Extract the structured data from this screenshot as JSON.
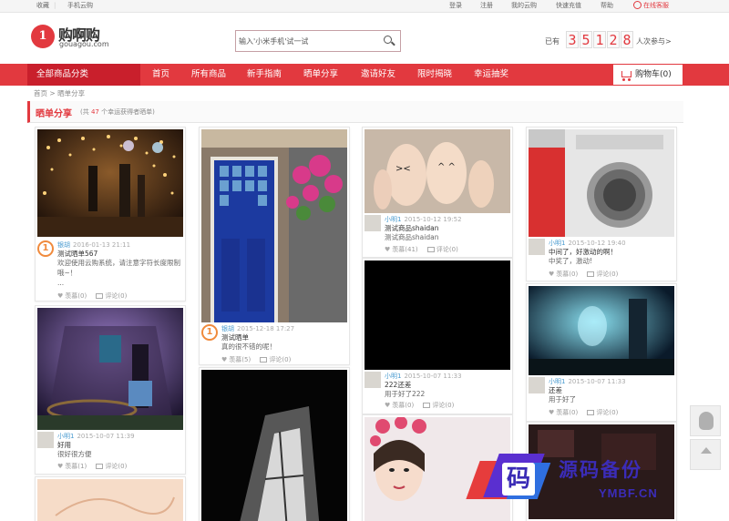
{
  "topbar": {
    "favorite": "收藏",
    "mobile": "手机云购",
    "login": "登录",
    "register": "注册",
    "my_yungou": "我的云购",
    "recharge": "快速充值",
    "help": "帮助",
    "service": "在线客服"
  },
  "header": {
    "logo_mark": "1",
    "logo_cn": "购啊购",
    "logo_en": "gouagou.com",
    "search_placeholder": "输入'小米手机'试一试",
    "counter_prefix": "已有",
    "counter_digits": [
      "3",
      "5",
      "1",
      "2",
      "8"
    ],
    "counter_suffix": "人次参与>"
  },
  "nav": {
    "all_categories": "全部商品分类",
    "items": [
      "首页",
      "所有商品",
      "新手指南",
      "晒单分享",
      "邀请好友",
      "限时揭晓",
      "幸运抽奖"
    ],
    "cart": "购物车(0)"
  },
  "breadcrumb": {
    "home": "首页",
    "sep": ">",
    "current": "晒单分享"
  },
  "section": {
    "title": "晒单分享",
    "count_prefix": "(共",
    "count": "47",
    "count_suffix": "个幸运获得者晒单)"
  },
  "posts": [
    {
      "user": "银胡",
      "time": "2016-01-13 21:11",
      "title": "测试晒单567",
      "desc": "欢迎使用云购系统，请注意字符长度限制哦~！",
      "desc2": "...",
      "likes": "羡慕(0)",
      "comments": "评论(0)"
    },
    {
      "user": "小明1",
      "time": "2015-10-07 11:39",
      "title": "好用",
      "desc": "很好很方便",
      "likes": "羡慕(1)",
      "comments": "评论(0)"
    },
    {
      "user": "银胡",
      "time": "2015-12-18 17:27",
      "title": "测试晒单",
      "desc": "真的很不错的呢！",
      "likes": "羡慕(5)",
      "comments": "评论(0)"
    },
    {
      "user": "小明1",
      "time": "2015-10-12 19:52",
      "title": "测试商品shaidan",
      "desc": "测试商品shaidan",
      "likes": "羡慕(41)",
      "comments": "评论(0)"
    },
    {
      "user": "小明1",
      "time": "2015-10-07 11:33",
      "title": "222还差",
      "desc": "用于好了222",
      "likes": "羡慕(0)",
      "comments": "评论(0)"
    },
    {
      "user": "小明1",
      "time": "2015-10-12 19:40",
      "title": "中间了，好激动的啊！",
      "desc": "中奖了，激动!",
      "likes": "羡慕(0)",
      "comments": "评论(0)"
    },
    {
      "user": "小明1",
      "time": "2015-10-07 11:33",
      "title": "还差",
      "desc": "用于好了",
      "likes": "羡慕(0)",
      "comments": "评论(0)"
    }
  ],
  "watermark": {
    "char": "码",
    "cn": "源码备份",
    "en": "YMBF.CN"
  }
}
